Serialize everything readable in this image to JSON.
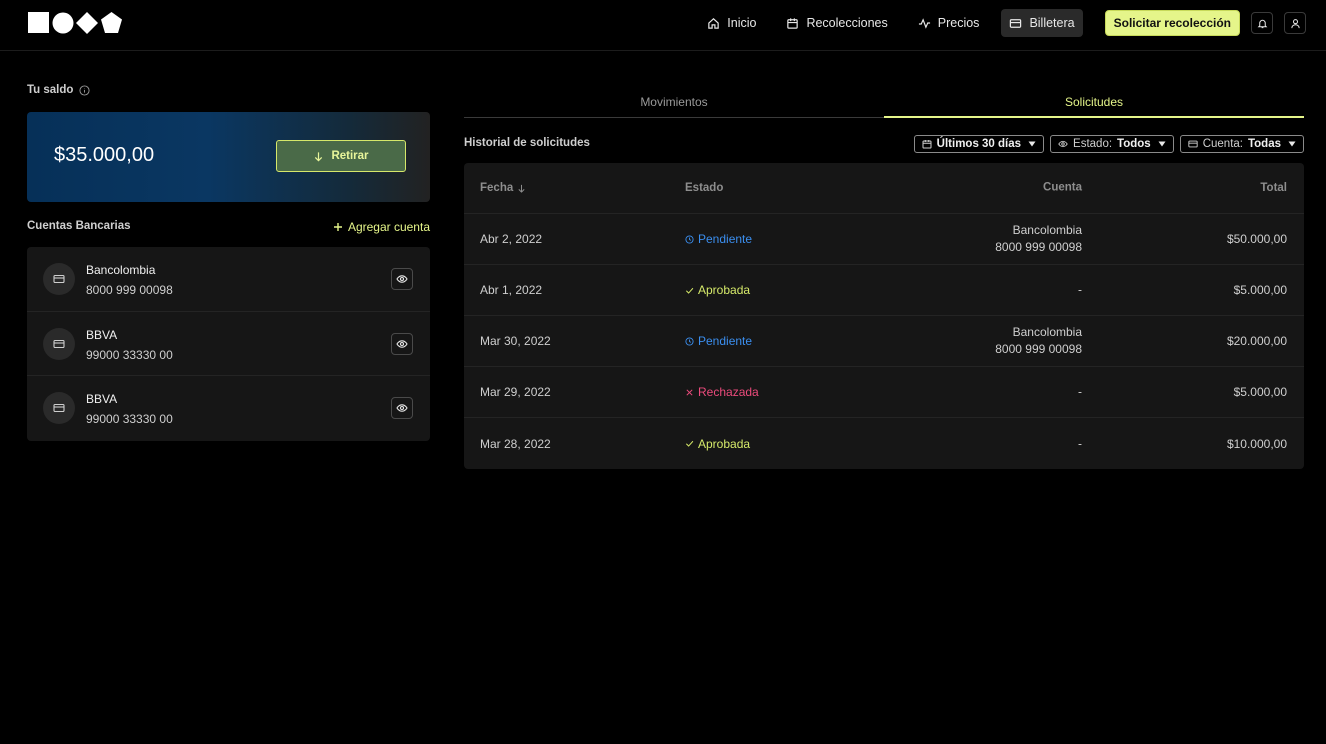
{
  "nav": {
    "items": [
      {
        "label": "Inicio",
        "icon": "home-icon"
      },
      {
        "label": "Recolecciones",
        "icon": "calendar-icon"
      },
      {
        "label": "Precios",
        "icon": "activity-icon"
      },
      {
        "label": "Billetera",
        "icon": "card-icon",
        "active": true
      }
    ],
    "cta_label": "Solicitar recolección"
  },
  "balance": {
    "label": "Tu saldo",
    "amount": "$35.000,00",
    "withdraw_label": "Retirar"
  },
  "accounts": {
    "title": "Cuentas Bancarias",
    "add_label": "Agregar cuenta",
    "items": [
      {
        "bank": "Bancolombia",
        "number": "8000 999 00098"
      },
      {
        "bank": "BBVA",
        "number": "99000 33330 00"
      },
      {
        "bank": "BBVA",
        "number": "99000 33330 00"
      }
    ]
  },
  "tabs": [
    {
      "label": "Movimientos",
      "active": false
    },
    {
      "label": "Solicitudes",
      "active": true
    }
  ],
  "history": {
    "title": "Historial de solicitudes",
    "filters": {
      "date_label": "Últimos 30 días",
      "status_prefix": "Estado:",
      "status_value": "Todos",
      "account_prefix": "Cuenta:",
      "account_value": "Todas"
    },
    "columns": {
      "fecha": "Fecha",
      "estado": "Estado",
      "cuenta": "Cuenta",
      "total": "Total"
    },
    "rows": [
      {
        "fecha": "Abr 2, 2022",
        "estado": "Pendiente",
        "status": "pending",
        "cuenta_bank": "Bancolombia",
        "cuenta_num": "8000 999 00098",
        "total": "$50.000,00"
      },
      {
        "fecha": "Abr 1, 2022",
        "estado": "Aprobada",
        "status": "approved",
        "cuenta_bank": "-",
        "cuenta_num": "",
        "total": "$5.000,00"
      },
      {
        "fecha": "Mar 30, 2022",
        "estado": "Pendiente",
        "status": "pending",
        "cuenta_bank": "Bancolombia",
        "cuenta_num": "8000 999 00098",
        "total": "$20.000,00"
      },
      {
        "fecha": "Mar 29, 2022",
        "estado": "Rechazada",
        "status": "rejected",
        "cuenta_bank": "-",
        "cuenta_num": "",
        "total": "$5.000,00"
      },
      {
        "fecha": "Mar 28, 2022",
        "estado": "Aprobada",
        "status": "approved",
        "cuenta_bank": "-",
        "cuenta_num": "",
        "total": "$10.000,00"
      }
    ]
  },
  "colors": {
    "accent": "#e5f58a",
    "pending": "#3b8ff0",
    "approved": "#d6ea6a",
    "rejected": "#ec4b7c"
  }
}
